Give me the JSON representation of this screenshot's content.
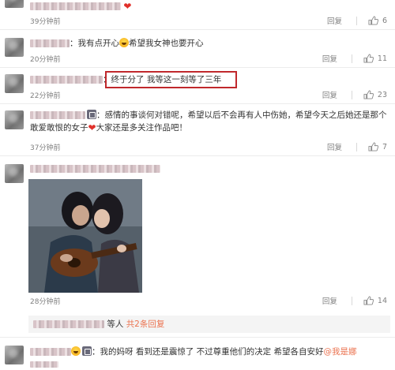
{
  "comments": [
    {
      "text": "",
      "time": "39分钟前",
      "reply": "回复",
      "likes": "6"
    },
    {
      "text": "我有点开心",
      "text2": "希望我女神也要开心",
      "time": "20分钟前",
      "reply": "回复",
      "likes": "11"
    },
    {
      "text": "终于分了 我等这一刻等了三年",
      "time": "22分钟前",
      "reply": "回复",
      "likes": "23"
    },
    {
      "text": "感情的事谈何对错呢，希望以后不会再有人中伤她，希望今天之后她还是那个敢爱敢恨的女子",
      "text2": "大家还是多关注作品吧！",
      "time": "37分钟前",
      "reply": "回复",
      "likes": "7"
    },
    {
      "time": "28分钟前",
      "reply": "回复",
      "likes": "14",
      "sub_who": "等人",
      "sub_link": "共2条回复"
    },
    {
      "text": "我的妈呀 看到还是震惊了 不过尊重他们的决定 希望各自安好",
      "mention": "@我是娜"
    }
  ],
  "colors": {
    "highlight": "#c0282c",
    "link": "#eb7350",
    "heart": "#e0302a"
  },
  "icons": [
    "thumb-up-icon",
    "heart-emoji",
    "grin-emoji",
    "badge-icon"
  ]
}
